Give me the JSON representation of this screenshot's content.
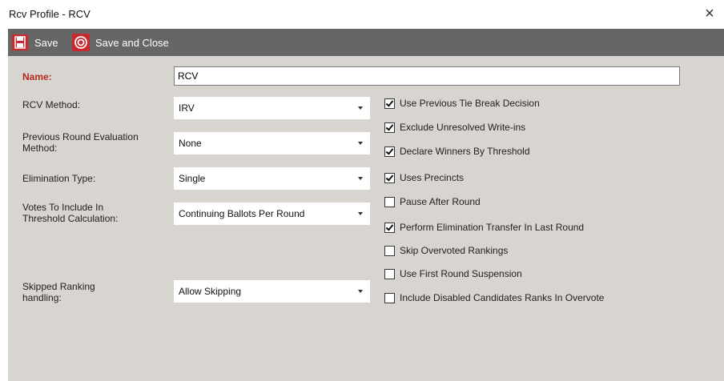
{
  "window": {
    "title": "Rcv Profile - RCV",
    "close_glyph": "×"
  },
  "toolbar": {
    "save_label": "Save",
    "save_close_label": "Save and Close",
    "save_icon": "floppy-disk-icon",
    "save_close_icon": "target-icon"
  },
  "form": {
    "name_label": "Name:",
    "name_value": "RCV",
    "rcv_method_label": "RCV Method:",
    "rcv_method_value": "IRV",
    "prev_round_label_1": "Previous Round Evaluation",
    "prev_round_label_2": "Method:",
    "prev_round_value": "None",
    "elimination_label": "Elimination Type:",
    "elimination_value": "Single",
    "votes_label_1": "Votes To Include In",
    "votes_label_2": "Threshold Calculation:",
    "votes_value": "Continuing Ballots Per Round",
    "skipped_label_1": "Skipped Ranking",
    "skipped_label_2": "handling:",
    "skipped_value": "Allow Skipping"
  },
  "options": [
    {
      "label": "Use Previous Tie Break Decision",
      "checked": true
    },
    {
      "label": "Exclude Unresolved Write-ins",
      "checked": true
    },
    {
      "label": "Declare Winners By Threshold",
      "checked": true
    },
    {
      "label": "Uses Precincts",
      "checked": true
    },
    {
      "label": "Pause After Round",
      "checked": false
    },
    {
      "label": "Perform Elimination Transfer In Last Round",
      "checked": true
    },
    {
      "label": "Skip Overvoted Rankings",
      "checked": false
    },
    {
      "label": "Use First Round Suspension",
      "checked": false
    },
    {
      "label": "Include Disabled Candidates Ranks In Overvote",
      "checked": false
    }
  ],
  "colors": {
    "toolbar_bg": "#666666",
    "content_bg": "#d8d5d0",
    "name_label": "#b22a1e",
    "icon_red": "#c8282e"
  }
}
